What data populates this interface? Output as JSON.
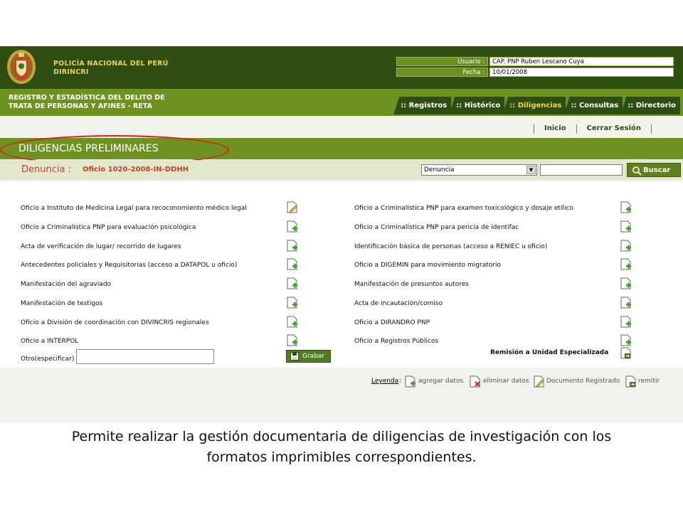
{
  "header": {
    "org_line1": "POLICÍA NACIONAL DEL PERÚ",
    "org_line2": "DIRINCRI",
    "user_label": "Usuario :",
    "user_value": "CAP. PNP  Ruben Lescano Cuya",
    "date_label": "Fecha :",
    "date_value": "10/01/2008"
  },
  "system": {
    "line1": "REGISTRO Y ESTADÍSTICA DEL DELITO DE",
    "line2": "TRATA DE PERSONAS Y AFINES - RETA"
  },
  "nav": {
    "tabs": [
      {
        "label": ":: Registros"
      },
      {
        "label": ":: Histórico"
      },
      {
        "label": ":: Diligencias"
      },
      {
        "label": ":: Consultas"
      },
      {
        "label": ":: Directorio"
      }
    ],
    "active_tab": ":: Diligencias"
  },
  "toplinks": {
    "inicio": "Inicio",
    "cerrar": "Cerrar Sesión"
  },
  "page_title": "DILIGENCIAS PRELIMINARES",
  "denuncia": {
    "label": "Denuncia :",
    "value": "Oficio 1020-2008-IN-DDHH",
    "select_value": "Denuncia",
    "search_value": "",
    "search_button": "Buscar"
  },
  "items_left": [
    "Oficio a Instituto de Medicina Legal para recoconomiento médico legal",
    "Oficio a Criminalística PNP para evaluación psicológica",
    "Acta de verificación de lugar/ recorrido de lugares",
    "Antecedentes policiales y Requisitorias (acceso a DATAPOL u oficio)",
    "Manifestación del agraviado",
    "Manifestación de testigos",
    "Oficio a División de coordinación con DIVINCRIS regionales",
    "Oficio a INTERPOL"
  ],
  "items_left_icons": [
    "edit-doc-icon",
    "add-doc-icon",
    "add-doc-icon",
    "add-doc-icon",
    "add-doc-icon",
    "add-doc-icon",
    "add-doc-icon",
    "add-doc-icon"
  ],
  "items_right": [
    "Oficio a Criminalística PNP para examen toxicológico y dosaje etílico",
    "Oficio a Criminalística PNP para pericia de identifac",
    "Identificación básica de personas (acceso a RENIEC u oficio)",
    "Oficio a DIGEMIN para movimiento migratorio",
    "Manifestación de presuntos autores",
    "Acta de incautación/comiso",
    "Oficio a DIRANDRO PNP",
    "Oficio a Registros Públicos"
  ],
  "otro": {
    "label": "Otro(especificar)",
    "value": "",
    "button": "Grabar"
  },
  "remision": "Remisión a Unidad Especializada",
  "legend": {
    "title": "Leyenda",
    "add": "agregar datos",
    "delete": "eliminar datos",
    "registered": "Documento Registrado",
    "send": "remitir"
  },
  "caption": {
    "line1": "Permite realizar la gestión documentaria de diligencias de investigación con los",
    "line2": "formatos imprimibles correspondientes."
  },
  "colors": {
    "header_dark": "#2f4f12",
    "green": "#6e9222",
    "gold": "#e8cf5a",
    "highlight_red": "#d42020",
    "denuncia_red": "#c0422a"
  }
}
